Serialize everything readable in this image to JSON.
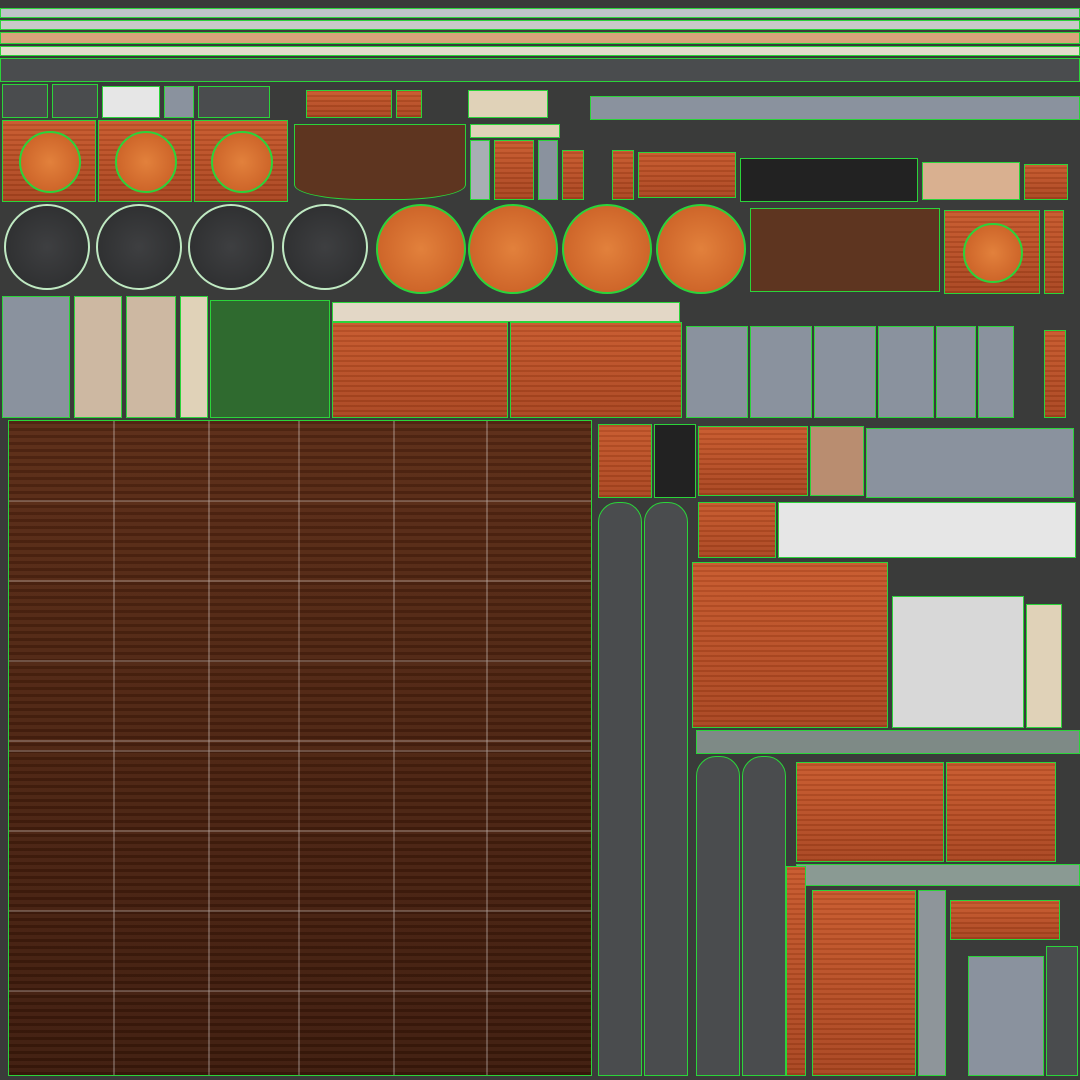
{
  "palette": {
    "line_primary": "#2bd43a",
    "line_secondary": "#ffffff",
    "wood_orange": "#c8582b",
    "wood_dark": "#4a200f",
    "slate": "#8a929e",
    "metal": "#4a4c4e",
    "background": "#3a3b3a"
  }
}
